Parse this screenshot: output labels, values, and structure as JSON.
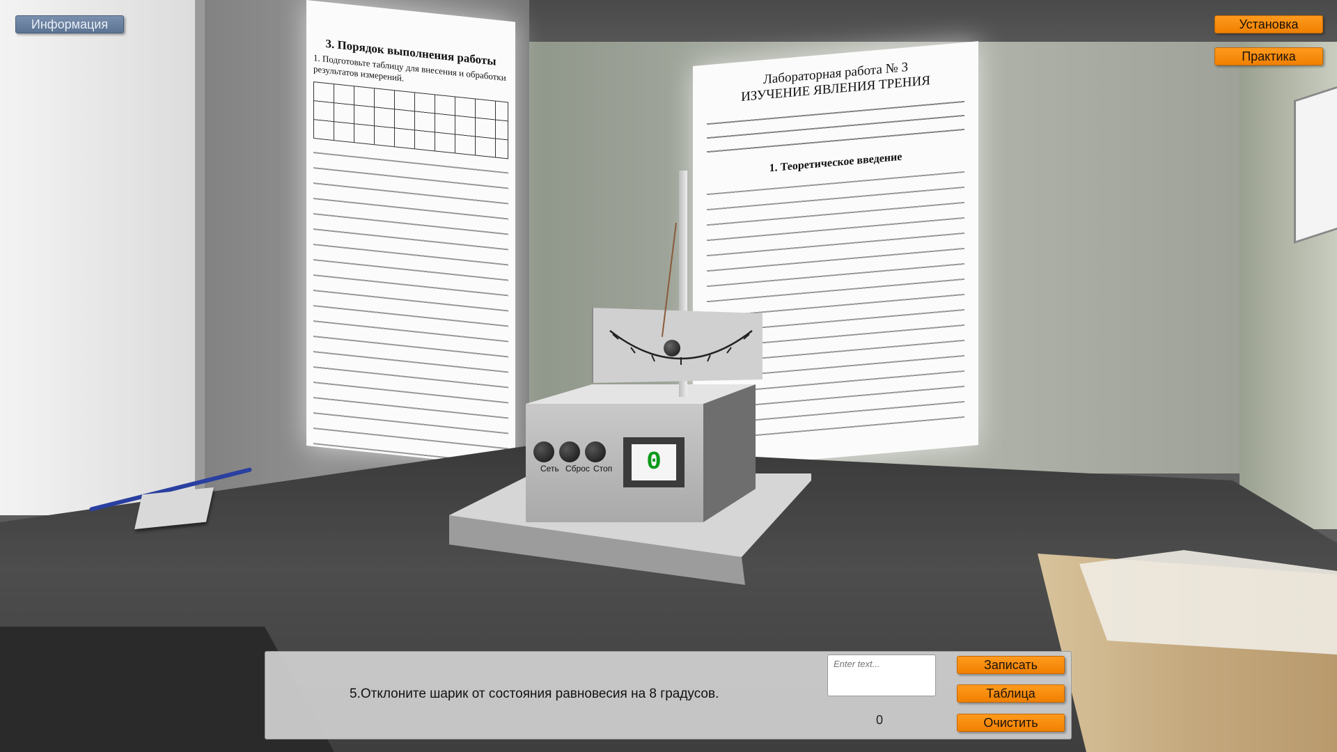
{
  "top_left": {
    "info_label": "Информация"
  },
  "top_right": {
    "setup_label": "Установка",
    "practice_label": "Практика"
  },
  "bottom_panel": {
    "instruction": "5.Отклоните шарик от состояния равновесия на 8 градусов.",
    "input_placeholder": "Enter text...",
    "input_value": "",
    "counter": "0",
    "record_label": "Записать",
    "table_label": "Таблица",
    "clear_label": "Очистить"
  },
  "device": {
    "display_value": "0",
    "knob_labels": [
      "Сеть",
      "Сброс",
      "Стоп"
    ]
  },
  "posters": {
    "left_title": "3. Порядок выполнения работы",
    "left_intro": "1. Подготовьте таблицу для внесения и обработки результатов измерений.",
    "right_lab": "Лабораторная работа № 3",
    "right_title": "ИЗУЧЕНИЕ ЯВЛЕНИЯ ТРЕНИЯ",
    "right_section": "1. Теоретическое введение"
  },
  "colors": {
    "accent_orange": "#f08000",
    "info_blue": "#5c7393",
    "display_green": "#0a9a1a"
  }
}
